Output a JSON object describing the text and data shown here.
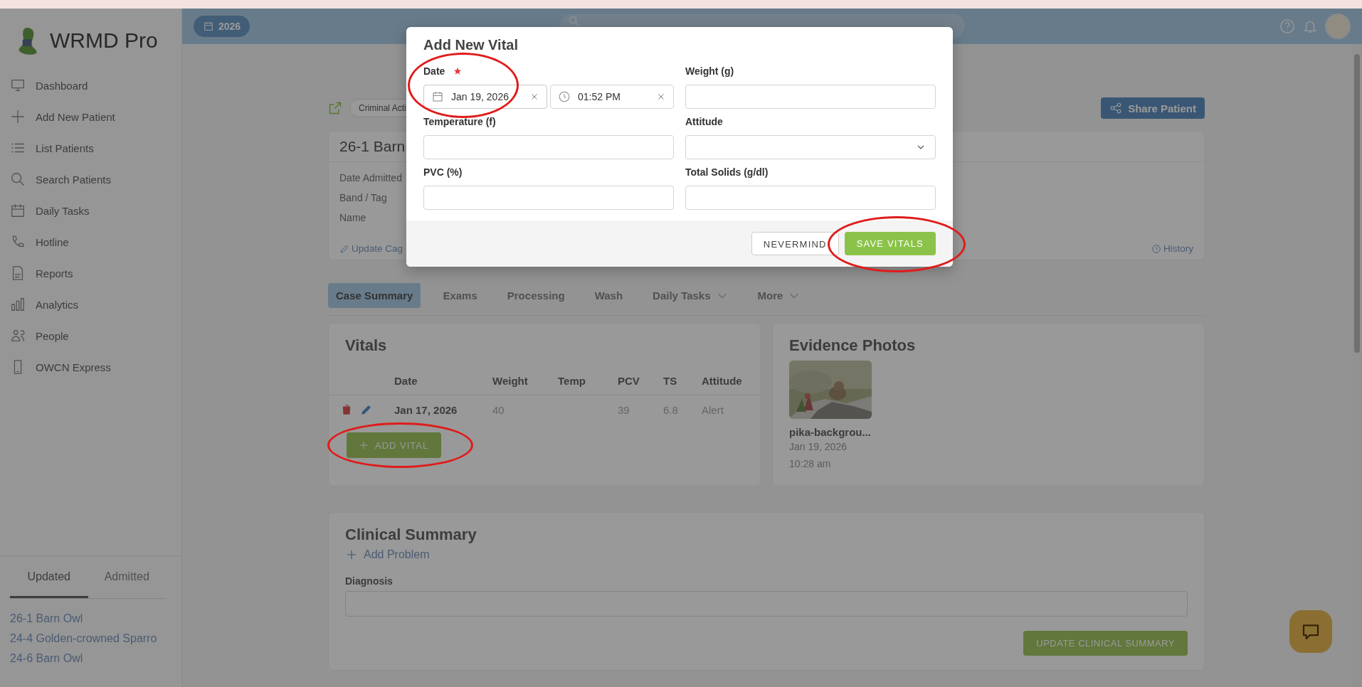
{
  "topbar": {
    "year": "2026"
  },
  "sidebar": {
    "logo": "WRMD Pro",
    "items": [
      {
        "label": "Dashboard"
      },
      {
        "label": "Add New Patient"
      },
      {
        "label": "List Patients"
      },
      {
        "label": "Search Patients"
      },
      {
        "label": "Daily Tasks"
      },
      {
        "label": "Hotline"
      },
      {
        "label": "Reports"
      },
      {
        "label": "Analytics"
      },
      {
        "label": "People"
      },
      {
        "label": "OWCN Express"
      }
    ],
    "tabs": [
      {
        "label": "Updated",
        "selected": true
      },
      {
        "label": "Admitted",
        "selected": false
      }
    ],
    "recent": [
      "26-1 Barn Owl",
      "24-4 Golden-crowned Sparro",
      "24-6 Barn Owl"
    ]
  },
  "header": {
    "tag": "Criminal Acti",
    "share_button": "Share Patient"
  },
  "patient": {
    "title": "26-1 Barn",
    "fields": [
      "Date Admitted",
      "Band / Tag",
      "Name"
    ],
    "update_link": "Update Cag",
    "history_link": "History"
  },
  "tabs": [
    {
      "label": "Case Summary",
      "selected": true,
      "dropdown": false
    },
    {
      "label": "Exams",
      "selected": false,
      "dropdown": false
    },
    {
      "label": "Processing",
      "selected": false,
      "dropdown": false
    },
    {
      "label": "Wash",
      "selected": false,
      "dropdown": false
    },
    {
      "label": "Daily Tasks",
      "selected": false,
      "dropdown": true
    },
    {
      "label": "More",
      "selected": false,
      "dropdown": true
    }
  ],
  "vitals": {
    "title": "Vitals",
    "columns": [
      "Date",
      "Weight",
      "Temp",
      "PCV",
      "TS",
      "Attitude"
    ],
    "rows": [
      {
        "cells": [
          "Jan 17, 2026",
          "40",
          null,
          "39",
          "6.8",
          "Alert"
        ]
      }
    ],
    "add_button": {
      "label": "ADD VITAL",
      "highlighted": true
    }
  },
  "evidence": {
    "title": "Evidence Photos",
    "photos": [
      {
        "kind": "picture",
        "name": "pika-backgrou...",
        "date": "Jan 19, 2026",
        "time": "10:28 am"
      }
    ]
  },
  "clinical": {
    "title": "Clinical Summary",
    "add_link": "Add Problem",
    "diagnosis_label": "Diagnosis",
    "update_button": "UPDATE CLINICAL SUMMARY"
  },
  "modal": {
    "title": "Add New Vital",
    "fields": [
      {
        "label": "Date",
        "kind": "datetime",
        "required": true,
        "date": "Jan 19, 2026",
        "time": "01:52 PM",
        "highlighted": true
      },
      {
        "label": "Weight (g)",
        "kind": "text",
        "required": false,
        "highlighted": false
      },
      {
        "label": "Temperature (f)",
        "kind": "text",
        "required": false,
        "highlighted": false
      },
      {
        "label": "Attitude",
        "kind": "select",
        "required": false,
        "highlighted": false
      },
      {
        "label": "PVC (%)",
        "kind": "text",
        "required": false,
        "highlighted": false
      },
      {
        "label": "Total Solids (g/dl)",
        "kind": "text",
        "required": false,
        "highlighted": false
      }
    ],
    "buttons": [
      {
        "label": "NEVERMIND",
        "kind": "secondary",
        "highlighted": false
      },
      {
        "label": "SAVE VITALS",
        "kind": "primary",
        "highlighted": true
      }
    ]
  }
}
